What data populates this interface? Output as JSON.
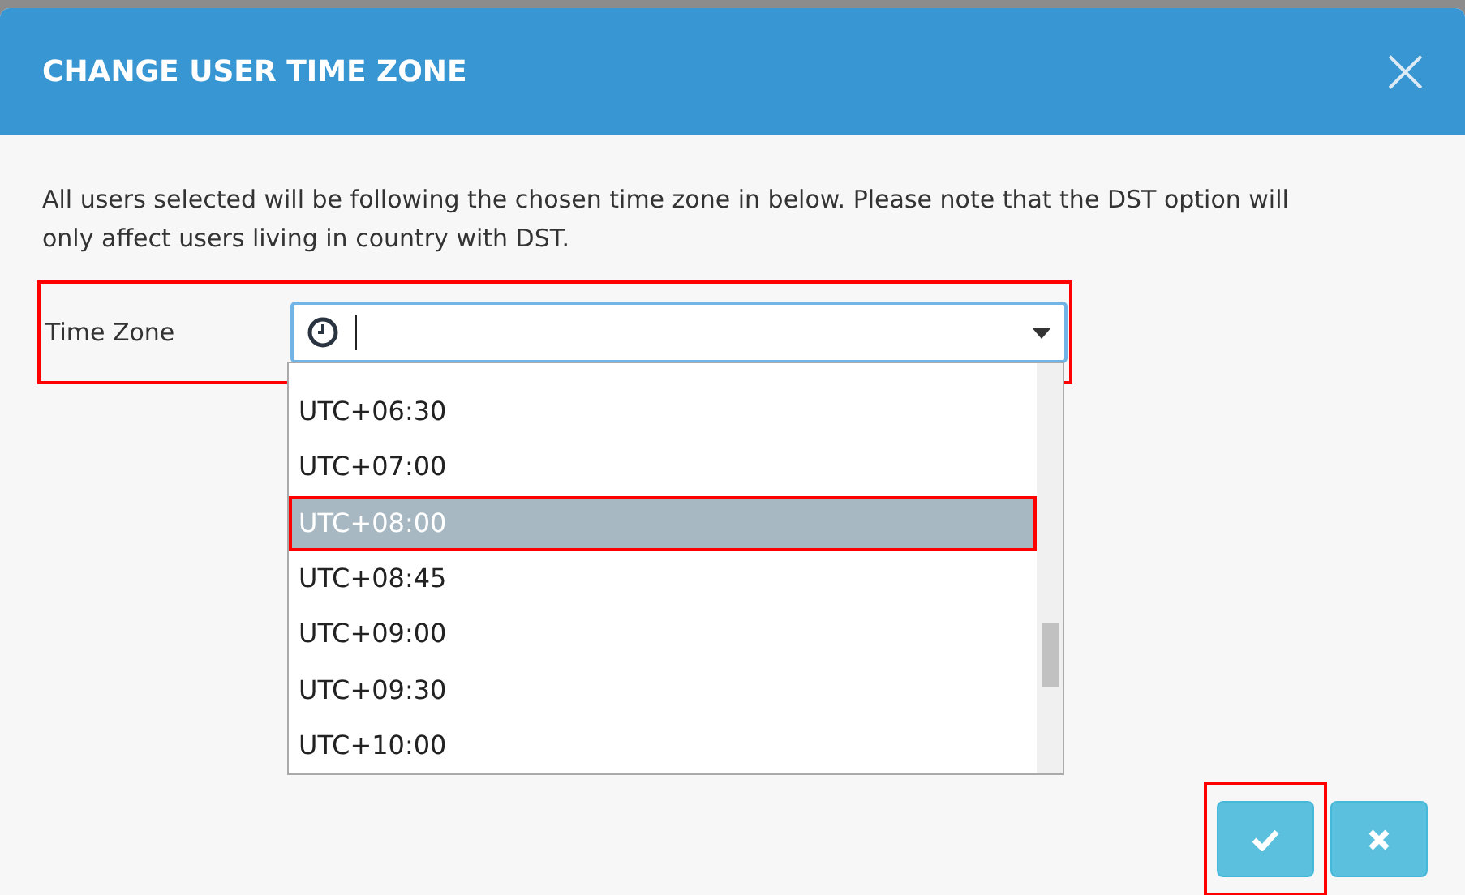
{
  "dialog": {
    "title": "CHANGE USER TIME ZONE",
    "close": "×"
  },
  "message": "All users selected will be following the chosen time zone in below. Please note that the DST option will only affect users living in country with DST.",
  "field": {
    "label": "Time Zone",
    "highlighted": true
  },
  "options": [
    {
      "label": "UTC+06:30",
      "selected": false,
      "highlighted": false
    },
    {
      "label": "UTC+07:00",
      "selected": false,
      "highlighted": false
    },
    {
      "label": "UTC+08:00",
      "selected": true,
      "highlighted": true
    },
    {
      "label": "UTC+08:45",
      "selected": false,
      "highlighted": false
    },
    {
      "label": "UTC+09:00",
      "selected": false,
      "highlighted": false
    },
    {
      "label": "UTC+09:30",
      "selected": false,
      "highlighted": false
    },
    {
      "label": "UTC+10:00",
      "selected": false,
      "highlighted": false
    }
  ],
  "buttons": [
    {
      "kind": "confirm",
      "highlighted": true
    },
    {
      "kind": "cancel",
      "highlighted": false
    }
  ]
}
